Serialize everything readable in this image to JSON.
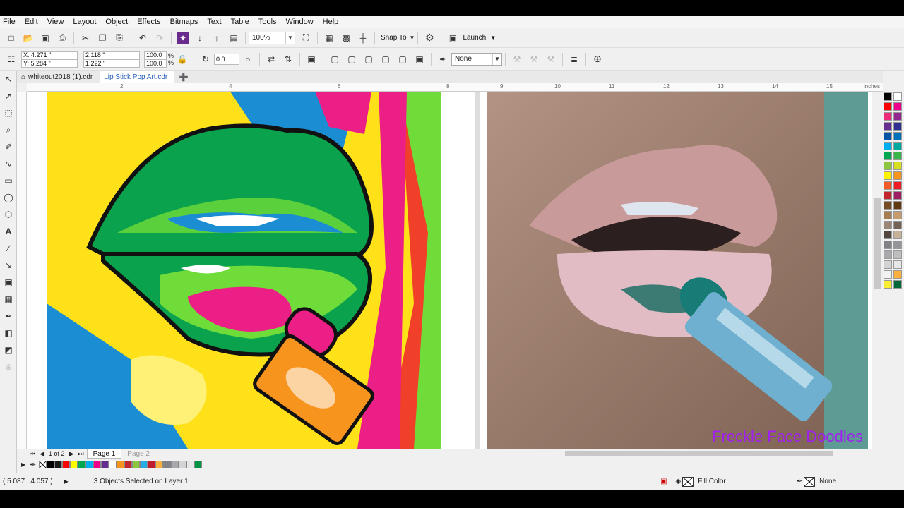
{
  "menu": [
    "File",
    "Edit",
    "View",
    "Layout",
    "Object",
    "Effects",
    "Bitmaps",
    "Text",
    "Table",
    "Tools",
    "Window",
    "Help"
  ],
  "standard_toolbar": {
    "zoom": "100%",
    "snap_to": "Snap To",
    "launch": "Launch"
  },
  "property_bar": {
    "x": "X: 4.271 \"",
    "y": "Y: 5.284 \"",
    "width": "2.118 \"",
    "height": "1.222 \"",
    "scale_w": "100.0",
    "scale_h": "100.0",
    "percent": "%",
    "rotation": "0.0",
    "outline": "None"
  },
  "tabs": [
    {
      "label": "whiteout2018 (1).cdr"
    },
    {
      "label": "Lip Stick Pop Art.cdr"
    }
  ],
  "ruler": {
    "ticks": [
      "2",
      "4",
      "6",
      "8",
      "9",
      "10",
      "11",
      "12",
      "13",
      "14",
      "15"
    ],
    "units": "inches"
  },
  "page_nav": {
    "count": "1  of 2",
    "page1": "Page 1",
    "page2": "Page 2"
  },
  "watermark": "Freckle Face Doodles",
  "status": {
    "coords": "( 5.087 , 4.057 )",
    "selection": "3 Objects Selected on Layer 1",
    "fill": "Fill Color",
    "outline": "None"
  },
  "colors": {
    "bottom_palette": [
      "#000000",
      "#1a1a1a",
      "#ff0000",
      "#ffff00",
      "#00a650",
      "#00aeef",
      "#ec008c",
      "#662d91",
      "#ffffff",
      "#f7941d",
      "#c1272d",
      "#8dc63f",
      "#29abe2",
      "#be1e2d",
      "#fbb040",
      "#808285",
      "#a7a9ac",
      "#d1d3d4",
      "#e6e7e8",
      "#009444"
    ],
    "right_palette": [
      "#000000",
      "#ffffff",
      "#ff0000",
      "#ec008c",
      "#ee2a7b",
      "#92278f",
      "#662d91",
      "#2e3192",
      "#0054a6",
      "#0072bc",
      "#00aeef",
      "#00a99d",
      "#00a651",
      "#39b54a",
      "#8dc63f",
      "#d7df23",
      "#fff200",
      "#f7941d",
      "#f15a29",
      "#ed1c24",
      "#c1272d",
      "#9e1f63",
      "#754c24",
      "#603913",
      "#a67c52",
      "#c69c6d",
      "#998675",
      "#736357",
      "#534741",
      "#c7b299",
      "#808285",
      "#939598",
      "#a7a9ac",
      "#bcbec0",
      "#d1d3d4",
      "#e6e7e8",
      "#f1f2f2",
      "#fbb040",
      "#f9ed32",
      "#006838"
    ]
  }
}
